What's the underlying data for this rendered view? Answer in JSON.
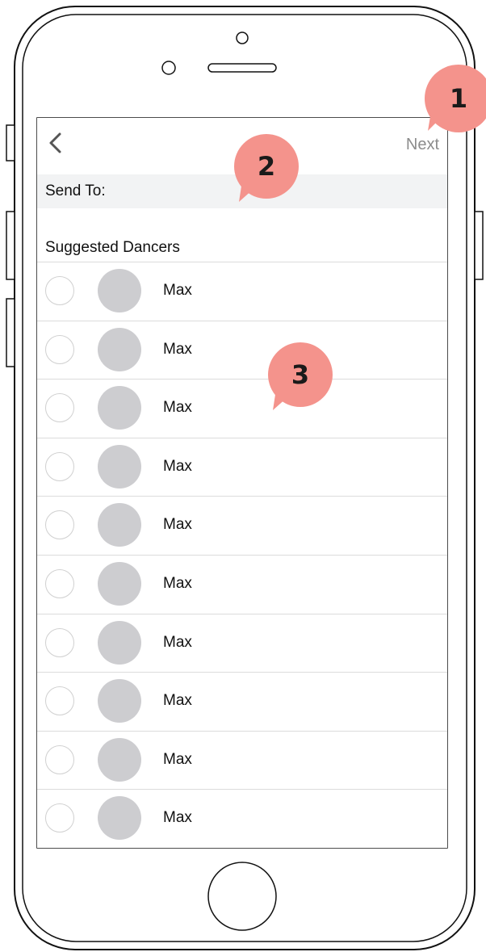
{
  "header": {
    "back_icon": "chevron-left-icon",
    "next_label": "Next"
  },
  "send_to": {
    "label": "Send To:"
  },
  "suggested": {
    "title": "Suggested Dancers",
    "items": [
      {
        "name": "Max",
        "selected": false
      },
      {
        "name": "Max",
        "selected": false
      },
      {
        "name": "Max",
        "selected": false
      },
      {
        "name": "Max",
        "selected": false
      },
      {
        "name": "Max",
        "selected": false
      },
      {
        "name": "Max",
        "selected": false
      },
      {
        "name": "Max",
        "selected": false
      },
      {
        "name": "Max",
        "selected": false
      },
      {
        "name": "Max",
        "selected": false
      },
      {
        "name": "Max",
        "selected": false
      }
    ]
  },
  "annotations": [
    "1",
    "2",
    "3"
  ],
  "colors": {
    "badge": "#f4938c",
    "avatar": "#cdcdd0",
    "next_text": "#8c8c8c",
    "sendto_bg": "#f2f3f4"
  }
}
